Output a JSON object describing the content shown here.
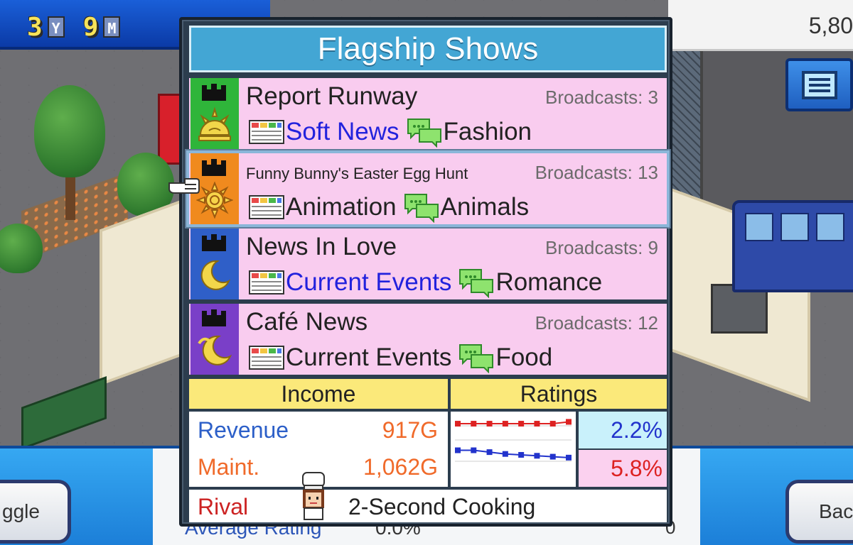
{
  "hud": {
    "years": "3",
    "year_unit": "Y",
    "months": "9",
    "month_unit": "M",
    "money": "5,80"
  },
  "modal": {
    "title": "Flagship Shows",
    "shows": [
      {
        "name": "Report Runway",
        "broadcasts": "Broadcasts: 3",
        "genre": "Soft News",
        "topic": "Fashion",
        "tile_color": "#2fb53a",
        "emblem": "sun-rising-icon"
      },
      {
        "name": "Funny Bunny's Easter Egg Hunt",
        "broadcasts": "Broadcasts: 13",
        "genre": "Animation",
        "topic": "Animals",
        "tile_color": "#f08a1e",
        "emblem": "sun-icon"
      },
      {
        "name": "News In Love",
        "broadcasts": "Broadcasts: 9",
        "genre": "Current Events",
        "topic": "Romance",
        "tile_color": "#2f5fc8",
        "emblem": "crescent-moon-icon"
      },
      {
        "name": "Café News",
        "broadcasts": "Broadcasts: 12",
        "genre": "Current Events",
        "topic": "Food",
        "tile_color": "#7a3fc8",
        "emblem": "crescent-moon-swirl-icon"
      }
    ],
    "income_header": "Income",
    "ratings_header": "Ratings",
    "revenue_label": "Revenue",
    "revenue_value": "917G",
    "maint_label": "Maint.",
    "maint_value": "1,062G",
    "rating_top": "2.2%",
    "rating_bottom": "5.8%",
    "rival_label": "Rival",
    "rival_name": "2-Second Cooking"
  },
  "ratings_chart": {
    "series": [
      {
        "color": "#dd2222",
        "values": [
          5.8,
          5.8,
          5.8,
          5.8,
          5.8,
          5.8,
          5.8,
          6.0
        ]
      },
      {
        "color": "#2233cc",
        "values": [
          2.9,
          2.9,
          2.7,
          2.5,
          2.4,
          2.3,
          2.2,
          2.1
        ]
      }
    ]
  },
  "bottom": {
    "toggle_label": "ggle",
    "back_label": "Bac",
    "under_label": "Average Rating",
    "under_value": "0.0%",
    "under_value2": "0"
  }
}
